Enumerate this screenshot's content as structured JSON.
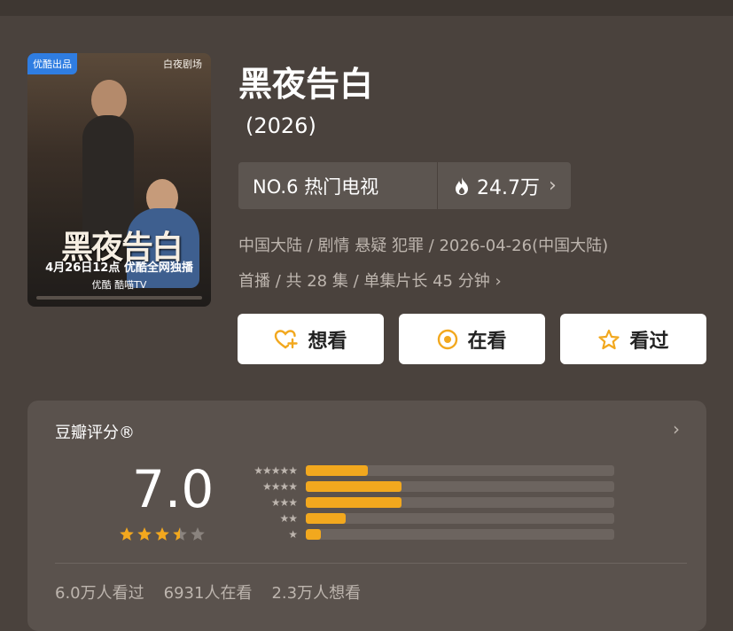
{
  "poster": {
    "badge": "优酷出品",
    "brand": "白夜剧场",
    "title": "黑夜告白",
    "release_line": "4月26日12点 优酷全网独播",
    "platforms": "优酷  酷喵TV"
  },
  "show": {
    "title": "黑夜告白",
    "year": "(2026)"
  },
  "rank": {
    "label": "NO.6 热门电视",
    "heat": "24.7万"
  },
  "meta": {
    "line1": "中国大陆 / 剧情 悬疑 犯罪 / 2026-04-26(中国大陆)",
    "line2": "首播 / 共 28 集 / 单集片长 45 分钟"
  },
  "actions": {
    "want": "想看",
    "watching": "在看",
    "watched": "看过"
  },
  "rating": {
    "label": "豆瓣评分®",
    "score": "7.0",
    "stars_value": 3.5,
    "distribution": [
      {
        "stars": 5,
        "fraction": 0.2
      },
      {
        "stars": 4,
        "fraction": 0.31
      },
      {
        "stars": 3,
        "fraction": 0.31
      },
      {
        "stars": 2,
        "fraction": 0.13
      },
      {
        "stars": 1,
        "fraction": 0.05
      }
    ]
  },
  "counts": {
    "watched": "6.0万人看过",
    "watching": "6931人在看",
    "want": "2.3万人想看"
  },
  "colors": {
    "background": "#4a423d",
    "accent": "#f2a81e",
    "card": "#5a524d"
  }
}
